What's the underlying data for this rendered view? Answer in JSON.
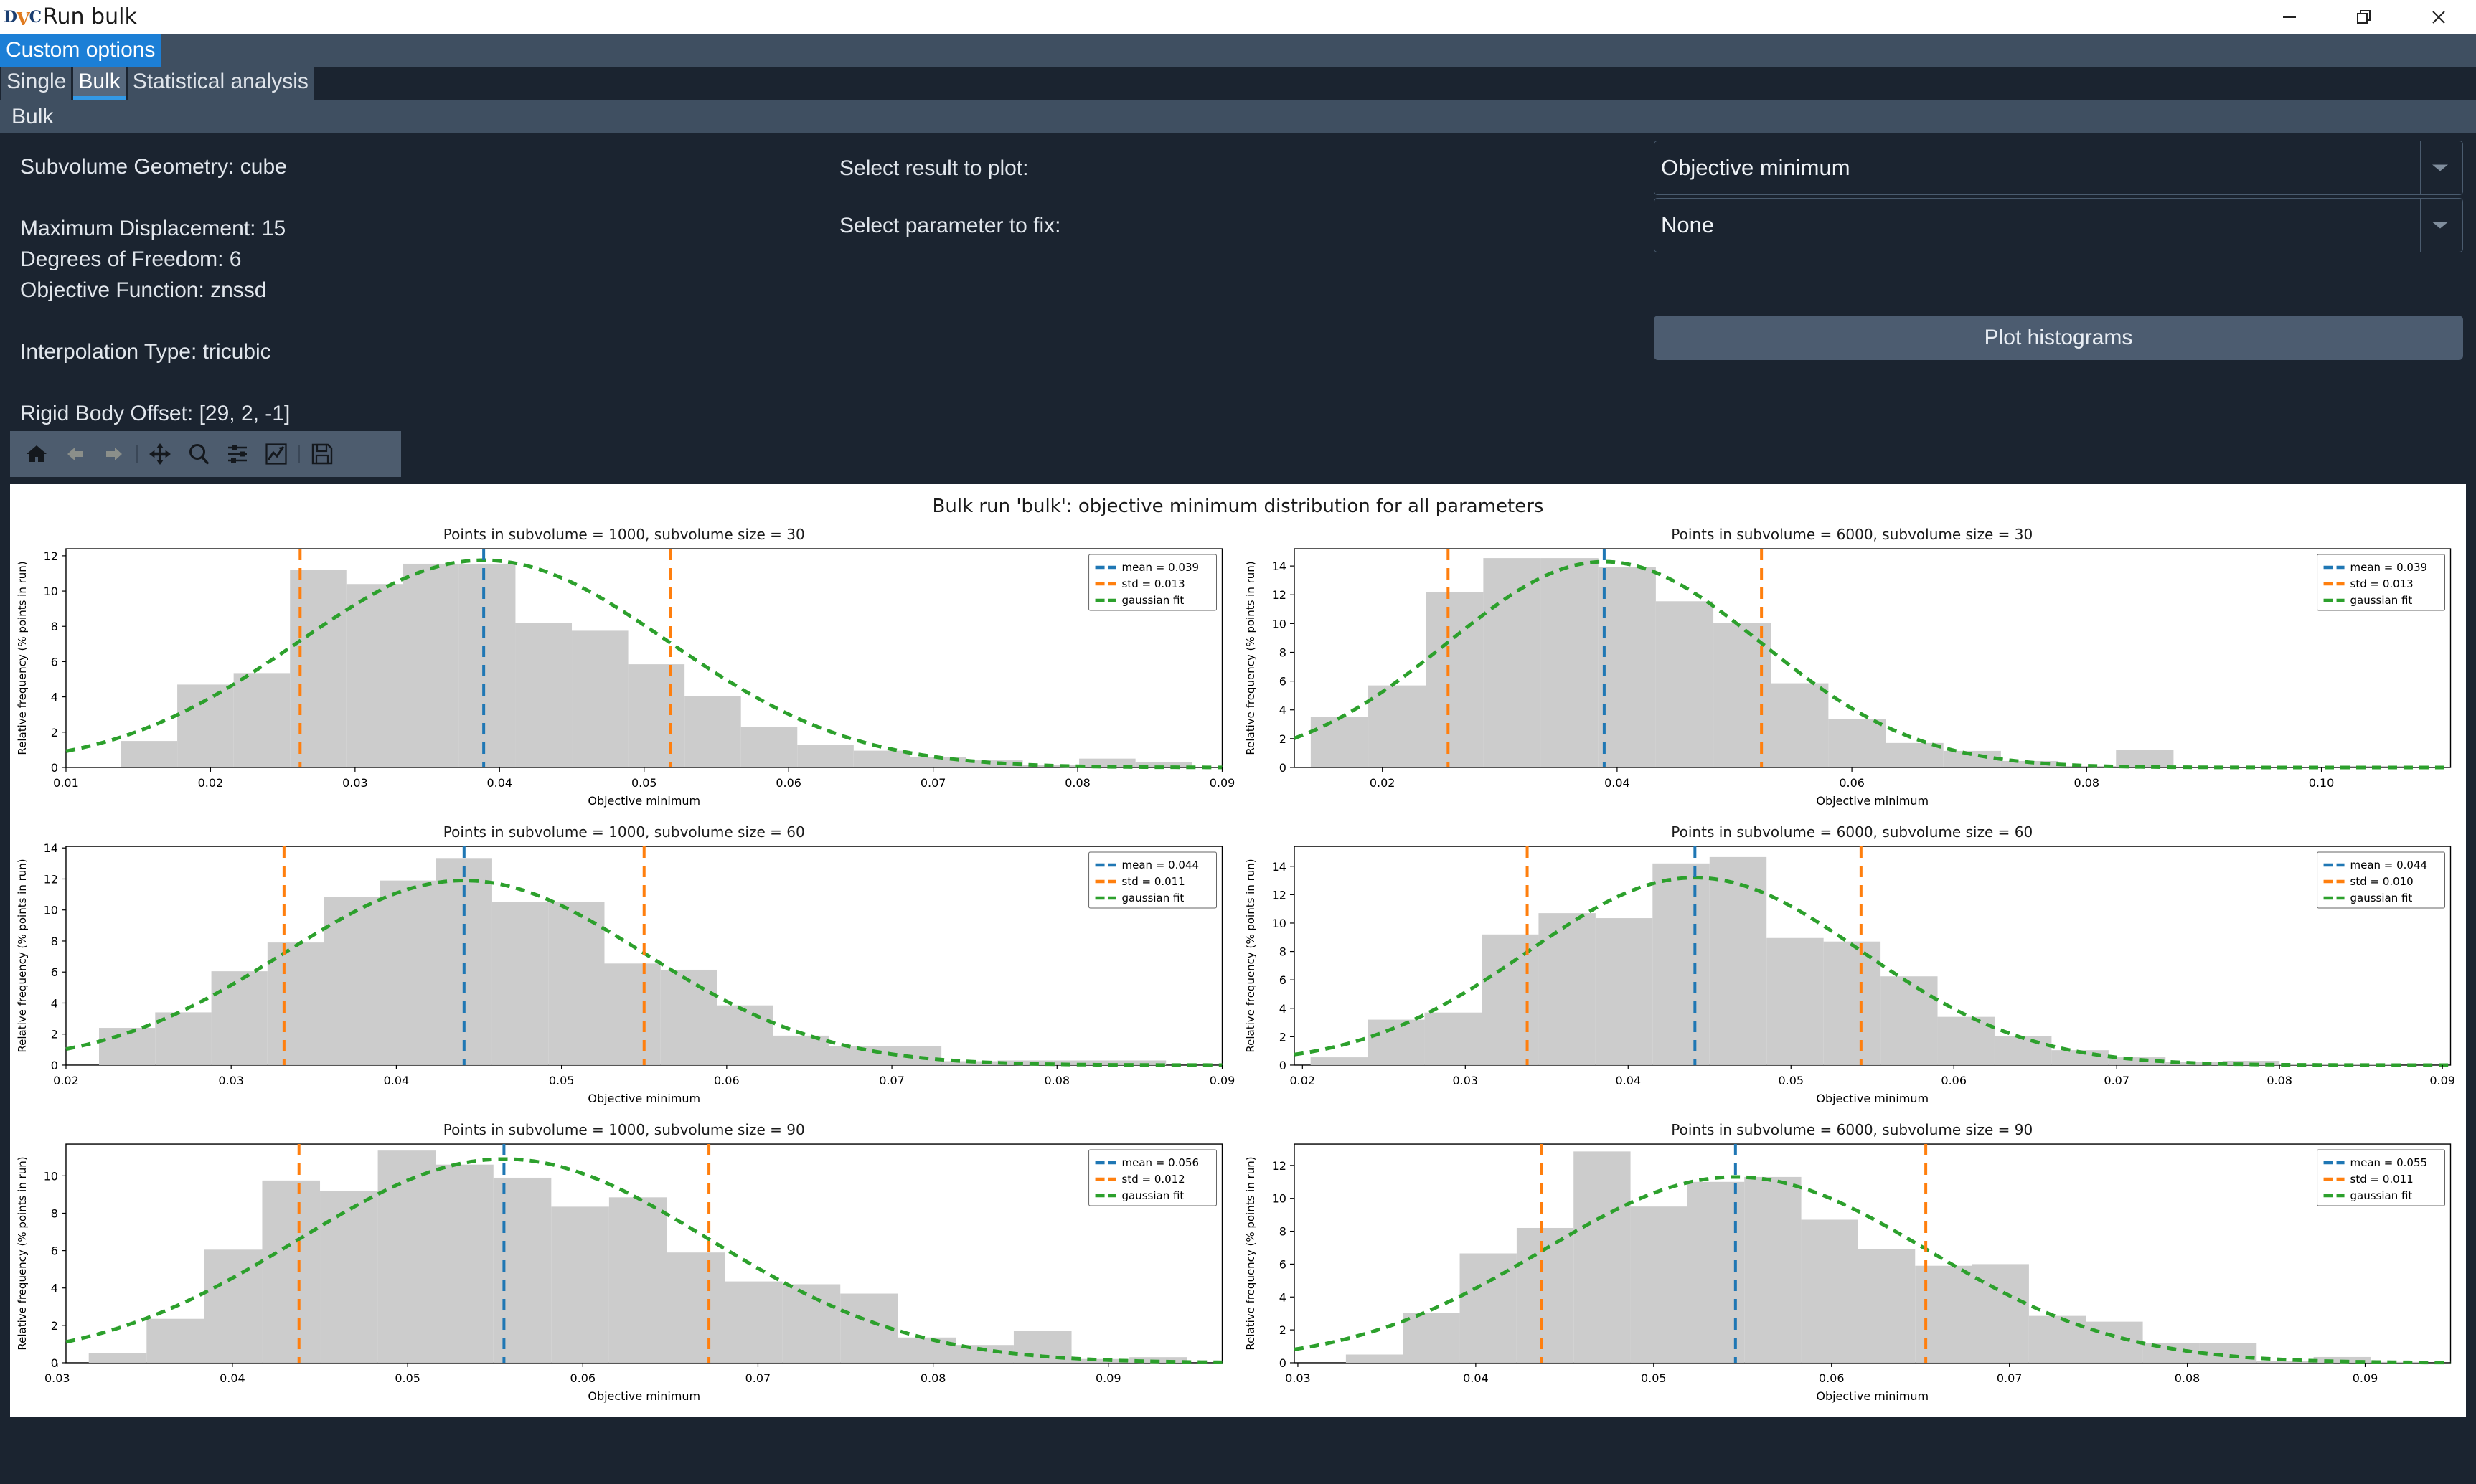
{
  "window": {
    "logo": [
      "D",
      "V",
      "C"
    ],
    "title": "Run bulk",
    "controls": {
      "minimize": "minimize-icon",
      "restore": "restore-icon",
      "close": "close-icon"
    }
  },
  "menubar": {
    "items": [
      "Custom options"
    ]
  },
  "tabs": [
    {
      "label": "Single",
      "active": false
    },
    {
      "label": "Bulk",
      "active": true
    },
    {
      "label": "Statistical analysis",
      "active": false
    }
  ],
  "section_header": "Bulk",
  "settings": {
    "info": [
      "Subvolume Geometry: cube",
      "",
      "Maximum Displacement: 15",
      "Degrees of Freedom: 6",
      "Objective Function: znssd",
      "",
      "Interpolation Type: tricubic",
      "",
      "Rigid Body Offset: [29, 2, -1]"
    ],
    "result_label": "Select result to plot:",
    "result_value": "Objective minimum",
    "param_label": "Select parameter to fix:",
    "param_value": "None",
    "plot_button": "Plot histograms"
  },
  "toolbar": {
    "buttons": [
      "home-icon",
      "back-arrow-icon",
      "forward-arrow-icon",
      "pan-move-icon",
      "zoom-magnifier-icon",
      "configure-subplots-icon",
      "edit-axis-curves-icon",
      "save-disk-icon"
    ]
  },
  "colors": {
    "accent_blue": "#1c7fd6",
    "panel": "#3f4f61",
    "background": "#1b2430",
    "mean_line": "#1f77b4",
    "std_line": "#ff7f0e",
    "gaussian": "#2ca02c",
    "hist_bar": "#cccccc"
  },
  "chart_data": [
    {
      "type": "bar",
      "index": 0,
      "title": "Points in subvolume = 1000, subvolume size = 30",
      "xlabel": "Objective minimum",
      "ylabel": "Relative frequency (% points in run)",
      "xlim": [
        0.01,
        0.09
      ],
      "ylim": [
        0,
        12.4
      ],
      "xticks": [
        0.01,
        0.02,
        0.03,
        0.04,
        0.05,
        0.06,
        0.07,
        0.08,
        0.09
      ],
      "xtick_labels": [
        "0.01",
        "0.02",
        "0.03",
        "0.04",
        "0.05",
        "0.06",
        "0.07",
        "0.08",
        "0.09"
      ],
      "yticks": [
        0,
        2,
        4,
        6,
        8,
        10,
        12
      ],
      "ytick_labels": [
        "0",
        "2",
        "4",
        "6",
        "8",
        "10",
        "12"
      ],
      "bin_edges": [
        0.0138,
        0.0177,
        0.0216,
        0.0255,
        0.0294,
        0.0333,
        0.0372,
        0.0411,
        0.045,
        0.0489,
        0.0528,
        0.0567,
        0.0606,
        0.0645,
        0.0684,
        0.0723,
        0.0762,
        0.0801,
        0.084,
        0.0879
      ],
      "values": [
        1.5,
        4.7,
        5.35,
        11.2,
        10.4,
        11.55,
        11.55,
        8.2,
        7.75,
        5.85,
        4.05,
        2.3,
        1.3,
        0.95,
        0.6,
        0.4,
        0.15,
        0.5,
        0.3
      ],
      "mean": 0.039,
      "std": 0.013,
      "mean_line_x": 0.0389,
      "std_line_x": [
        0.0262,
        0.0518
      ],
      "gauss_peak": 11.75,
      "legend": [
        "mean = 0.039",
        "std = 0.013",
        "gaussian fit"
      ],
      "legend_position": "upper right"
    },
    {
      "type": "bar",
      "index": 1,
      "title": "Points in subvolume = 6000, subvolume size = 30",
      "xlabel": "Objective minimum",
      "ylabel": "Relative frequency (% points in run)",
      "xlim": [
        0.0125,
        0.111
      ],
      "ylim": [
        0,
        15.2
      ],
      "xticks": [
        0.02,
        0.04,
        0.06,
        0.08,
        0.1
      ],
      "xtick_labels": [
        "0.02",
        "0.04",
        "0.06",
        "0.08",
        "0.10"
      ],
      "yticks": [
        0,
        2,
        4,
        6,
        8,
        10,
        12,
        14
      ],
      "ytick_labels": [
        "0",
        "2",
        "4",
        "6",
        "8",
        "10",
        "12",
        "14"
      ],
      "bin_edges": [
        0.0139,
        0.0188,
        0.0237,
        0.0286,
        0.0335,
        0.0384,
        0.0433,
        0.0482,
        0.0531,
        0.058,
        0.0629,
        0.0678,
        0.0727,
        0.0776,
        0.0825,
        0.0874,
        0.0923,
        0.0972,
        0.1021,
        0.107
      ],
      "values": [
        3.5,
        5.7,
        12.2,
        14.55,
        14.55,
        13.95,
        11.55,
        10.05,
        5.85,
        3.35,
        1.7,
        1.15,
        0.45,
        0.1,
        1.2,
        0.05,
        0.05,
        0.05,
        0.1
      ],
      "mean": 0.039,
      "std": 0.013,
      "mean_line_x": 0.0389,
      "std_line_x": [
        0.0256,
        0.0523
      ],
      "gauss_peak": 14.3,
      "legend": [
        "mean = 0.039",
        "std = 0.013",
        "gaussian fit"
      ],
      "legend_position": "upper right"
    },
    {
      "type": "bar",
      "index": 2,
      "title": "Points in subvolume = 1000, subvolume size = 60",
      "xlabel": "Objective minimum",
      "ylabel": "Relative frequency (% points in run)",
      "xlim": [
        0.02,
        0.09
      ],
      "ylim": [
        0,
        14.1
      ],
      "xticks": [
        0.02,
        0.03,
        0.04,
        0.05,
        0.06,
        0.07,
        0.08,
        0.09
      ],
      "xtick_labels": [
        "0.02",
        "0.03",
        "0.04",
        "0.05",
        "0.06",
        "0.07",
        "0.08",
        "0.09"
      ],
      "yticks": [
        0,
        2,
        4,
        6,
        8,
        10,
        12,
        14
      ],
      "ytick_labels": [
        "0",
        "2",
        "4",
        "6",
        "8",
        "10",
        "12",
        "14"
      ],
      "bin_edges": [
        0.022,
        0.0254,
        0.0288,
        0.0322,
        0.0356,
        0.039,
        0.0424,
        0.0458,
        0.0492,
        0.0526,
        0.056,
        0.0594,
        0.0628,
        0.0662,
        0.0696,
        0.073,
        0.0764,
        0.0798,
        0.0832,
        0.0866
      ],
      "values": [
        2.4,
        3.4,
        6.05,
        7.9,
        10.85,
        11.9,
        13.35,
        10.5,
        10.5,
        6.55,
        6.15,
        3.85,
        1.9,
        1.2,
        1.2,
        0.25,
        0.3,
        0.3,
        0.3
      ],
      "mean": 0.044,
      "std": 0.011,
      "mean_line_x": 0.0441,
      "std_line_x": [
        0.0332,
        0.055
      ],
      "gauss_peak": 11.9,
      "legend": [
        "mean = 0.044",
        "std = 0.011",
        "gaussian fit"
      ],
      "legend_position": "upper right"
    },
    {
      "type": "bar",
      "index": 3,
      "title": "Points in subvolume = 6000, subvolume size = 60",
      "xlabel": "Objective minimum",
      "ylabel": "Relative frequency (% points in run)",
      "xlim": [
        0.0195,
        0.0905
      ],
      "ylim": [
        0,
        15.4
      ],
      "xticks": [
        0.02,
        0.03,
        0.04,
        0.05,
        0.06,
        0.07,
        0.08,
        0.09
      ],
      "xtick_labels": [
        "0.02",
        "0.03",
        "0.04",
        "0.05",
        "0.06",
        "0.07",
        "0.08",
        "0.09"
      ],
      "yticks": [
        0,
        2,
        4,
        6,
        8,
        10,
        12,
        14
      ],
      "ytick_labels": [
        "0",
        "2",
        "4",
        "6",
        "8",
        "10",
        "12",
        "14"
      ],
      "bin_edges": [
        0.0205,
        0.024,
        0.0275,
        0.031,
        0.0345,
        0.038,
        0.0415,
        0.045,
        0.0485,
        0.052,
        0.0555,
        0.059,
        0.0625,
        0.066,
        0.0695,
        0.073,
        0.0765,
        0.08,
        0.0835,
        0.087
      ],
      "values": [
        0.55,
        3.2,
        3.7,
        9.2,
        10.7,
        10.35,
        14.2,
        14.65,
        8.95,
        8.7,
        6.25,
        3.4,
        2.05,
        1.05,
        0.55,
        0.2,
        0.3,
        0.1,
        0.1
      ],
      "mean": 0.044,
      "std": 0.01,
      "mean_line_x": 0.0441,
      "std_line_x": [
        0.0338,
        0.0543
      ],
      "gauss_peak": 13.2,
      "legend": [
        "mean = 0.044",
        "std = 0.010",
        "gaussian fit"
      ],
      "legend_position": "upper right"
    },
    {
      "type": "bar",
      "index": 4,
      "title": "Points in subvolume = 1000, subvolume size = 90",
      "xlabel": "Objective minimum",
      "ylabel": "Relative frequency (% points in run)",
      "xlim": [
        0.0305,
        0.0965
      ],
      "ylim": [
        0,
        11.7
      ],
      "xticks": [
        0.03,
        0.04,
        0.05,
        0.06,
        0.07,
        0.08,
        0.09
      ],
      "xtick_labels": [
        "0.03",
        "0.04",
        "0.05",
        "0.06",
        "0.07",
        "0.08",
        "0.09"
      ],
      "yticks": [
        0,
        2,
        4,
        6,
        8,
        10
      ],
      "ytick_labels": [
        "0",
        "2",
        "4",
        "6",
        "8",
        "10"
      ],
      "bin_edges": [
        0.0318,
        0.0351,
        0.0384,
        0.0417,
        0.045,
        0.0483,
        0.0516,
        0.0549,
        0.0582,
        0.0615,
        0.0648,
        0.0681,
        0.0714,
        0.0747,
        0.078,
        0.0813,
        0.0846,
        0.0879,
        0.0912,
        0.0945
      ],
      "values": [
        0.5,
        2.35,
        6.05,
        9.75,
        9.2,
        11.35,
        10.6,
        9.9,
        8.35,
        8.85,
        5.9,
        4.35,
        4.2,
        3.7,
        1.35,
        0.95,
        1.7,
        0.2,
        0.3
      ],
      "mean": 0.056,
      "std": 0.012,
      "mean_line_x": 0.0555,
      "std_line_x": [
        0.0438,
        0.0672
      ],
      "gauss_peak": 10.9,
      "legend": [
        "mean = 0.056",
        "std = 0.012",
        "gaussian fit"
      ],
      "legend_position": "upper right"
    },
    {
      "type": "bar",
      "index": 5,
      "title": "Points in subvolume = 6000, subvolume size = 90",
      "xlabel": "Objective minimum",
      "ylabel": "Relative frequency (% points in run)",
      "xlim": [
        0.0298,
        0.0948
      ],
      "ylim": [
        0,
        13.3
      ],
      "xticks": [
        0.03,
        0.04,
        0.05,
        0.06,
        0.07,
        0.08,
        0.09
      ],
      "xtick_labels": [
        "0.03",
        "0.04",
        "0.05",
        "0.06",
        "0.07",
        "0.08",
        "0.09"
      ],
      "yticks": [
        0,
        2,
        4,
        6,
        8,
        10,
        12
      ],
      "ytick_labels": [
        "0",
        "2",
        "4",
        "6",
        "8",
        "10",
        "12"
      ],
      "bin_edges": [
        0.0327,
        0.0359,
        0.0391,
        0.0423,
        0.0455,
        0.0487,
        0.0519,
        0.0551,
        0.0583,
        0.0615,
        0.0647,
        0.0679,
        0.0711,
        0.0743,
        0.0775,
        0.0807,
        0.0839,
        0.0871,
        0.0903,
        0.0935
      ],
      "values": [
        0.5,
        3.05,
        6.65,
        8.2,
        12.85,
        9.5,
        11.0,
        11.3,
        8.7,
        6.9,
        5.9,
        6.0,
        2.85,
        2.5,
        1.2,
        1.2,
        0.1,
        0.35,
        0.05
      ],
      "mean": 0.055,
      "std": 0.011,
      "mean_line_x": 0.0546,
      "std_line_x": [
        0.0437,
        0.0653
      ],
      "gauss_peak": 11.3,
      "legend": [
        "mean = 0.055",
        "std = 0.011",
        "gaussian fit"
      ],
      "legend_position": "upper right"
    }
  ],
  "figure": {
    "title": "Bulk run 'bulk': objective minimum distribution for all parameters"
  }
}
